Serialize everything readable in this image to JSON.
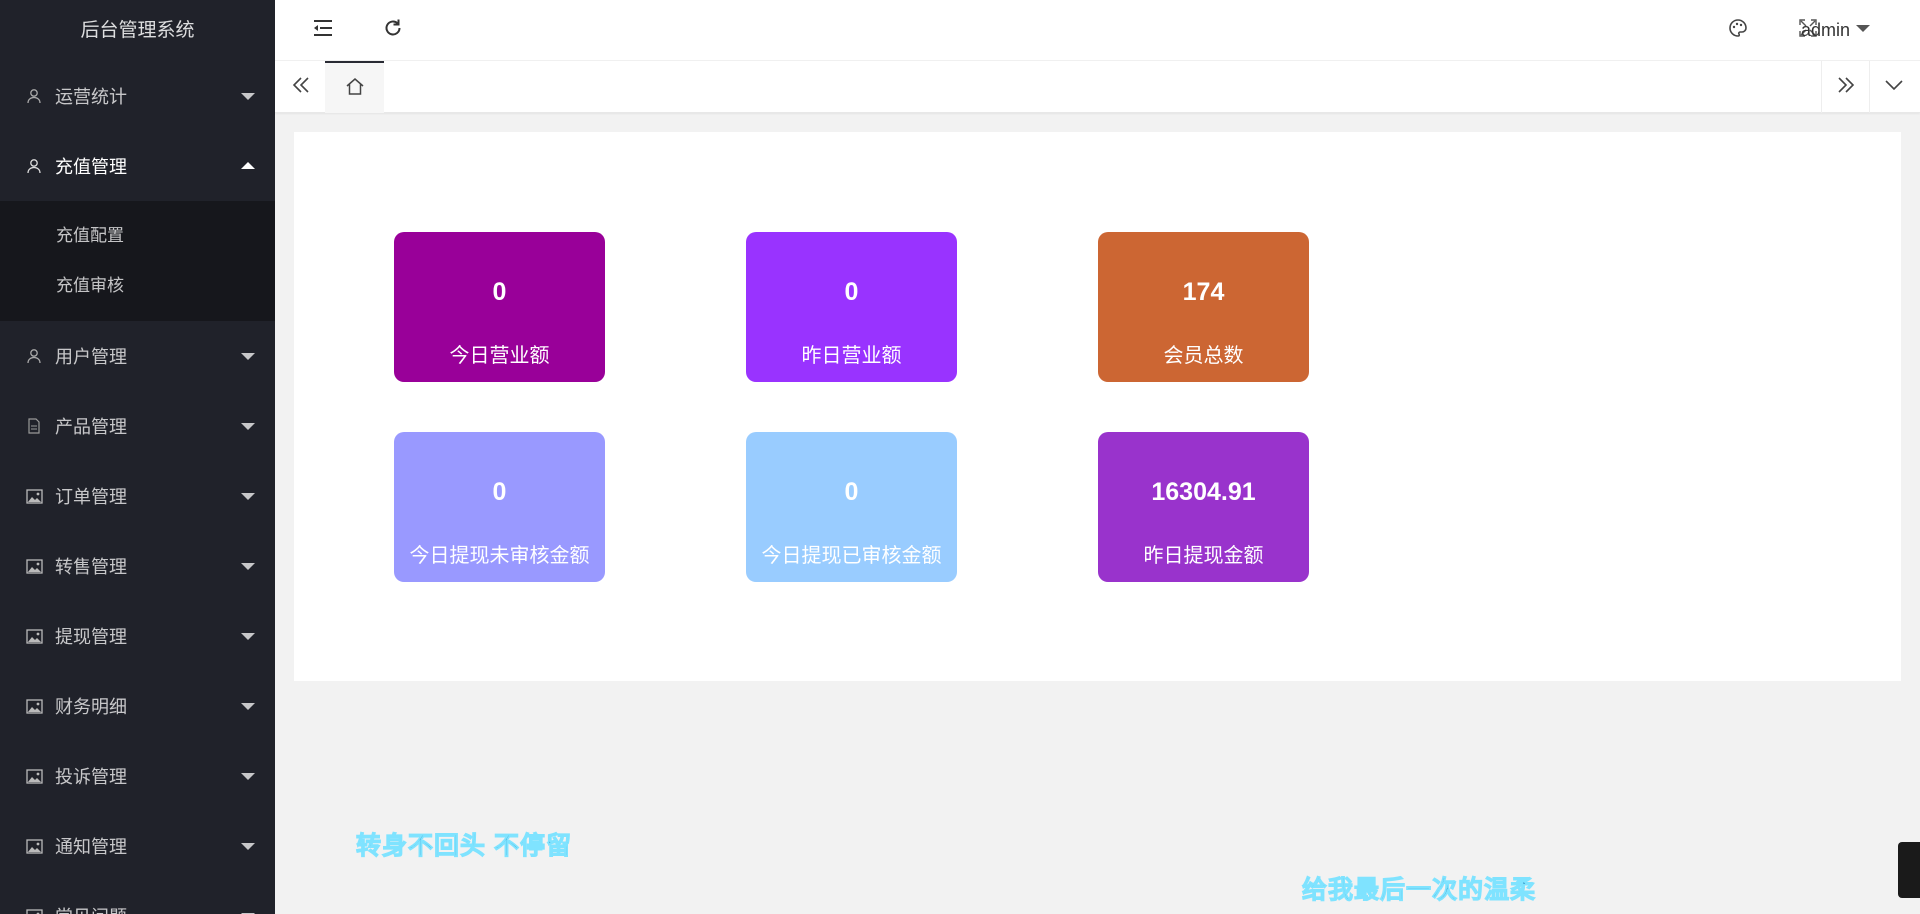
{
  "sidebar": {
    "logo": "后台管理系统",
    "items": [
      {
        "label": "运营统计",
        "icon": "user-icon",
        "open": false
      },
      {
        "label": "充值管理",
        "icon": "user-icon",
        "open": true,
        "children": [
          {
            "label": "充值配置"
          },
          {
            "label": "充值审核"
          }
        ]
      },
      {
        "label": "用户管理",
        "icon": "user-icon",
        "open": false
      },
      {
        "label": "产品管理",
        "icon": "document-icon",
        "open": false
      },
      {
        "label": "订单管理",
        "icon": "picture-icon",
        "open": false
      },
      {
        "label": "转售管理",
        "icon": "picture-icon",
        "open": false
      },
      {
        "label": "提现管理",
        "icon": "picture-icon",
        "open": false
      },
      {
        "label": "财务明细",
        "icon": "picture-icon",
        "open": false
      },
      {
        "label": "投诉管理",
        "icon": "picture-icon",
        "open": false
      },
      {
        "label": "通知管理",
        "icon": "picture-icon",
        "open": false
      },
      {
        "label": "常见问题",
        "icon": "picture-icon",
        "open": false
      }
    ]
  },
  "header": {
    "user": "admin",
    "icons": [
      "menu-collapse-icon",
      "refresh-icon",
      "theme-palette-icon",
      "fullscreen-icon"
    ]
  },
  "tabs": {
    "icons": [
      "double-chevron-left-icon",
      "home-icon",
      "double-chevron-right-icon",
      "chevron-down-icon"
    ]
  },
  "stats": [
    {
      "value": "0",
      "label": "今日营业额",
      "color": "#990099"
    },
    {
      "value": "0",
      "label": "昨日营业额",
      "color": "#9933ff"
    },
    {
      "value": "174",
      "label": "会员总数",
      "color": "#cc6633"
    },
    {
      "value": "0",
      "label": "今日提现未审核金额",
      "color": "#9999ff"
    },
    {
      "value": "0",
      "label": "今日提现已审核金额",
      "color": "#99ccff"
    },
    {
      "value": "16304.91",
      "label": "昨日提现金额",
      "color": "#9933cc"
    }
  ],
  "captions": [
    "转身不回头  不停留",
    "给我最后一次的温柔"
  ]
}
